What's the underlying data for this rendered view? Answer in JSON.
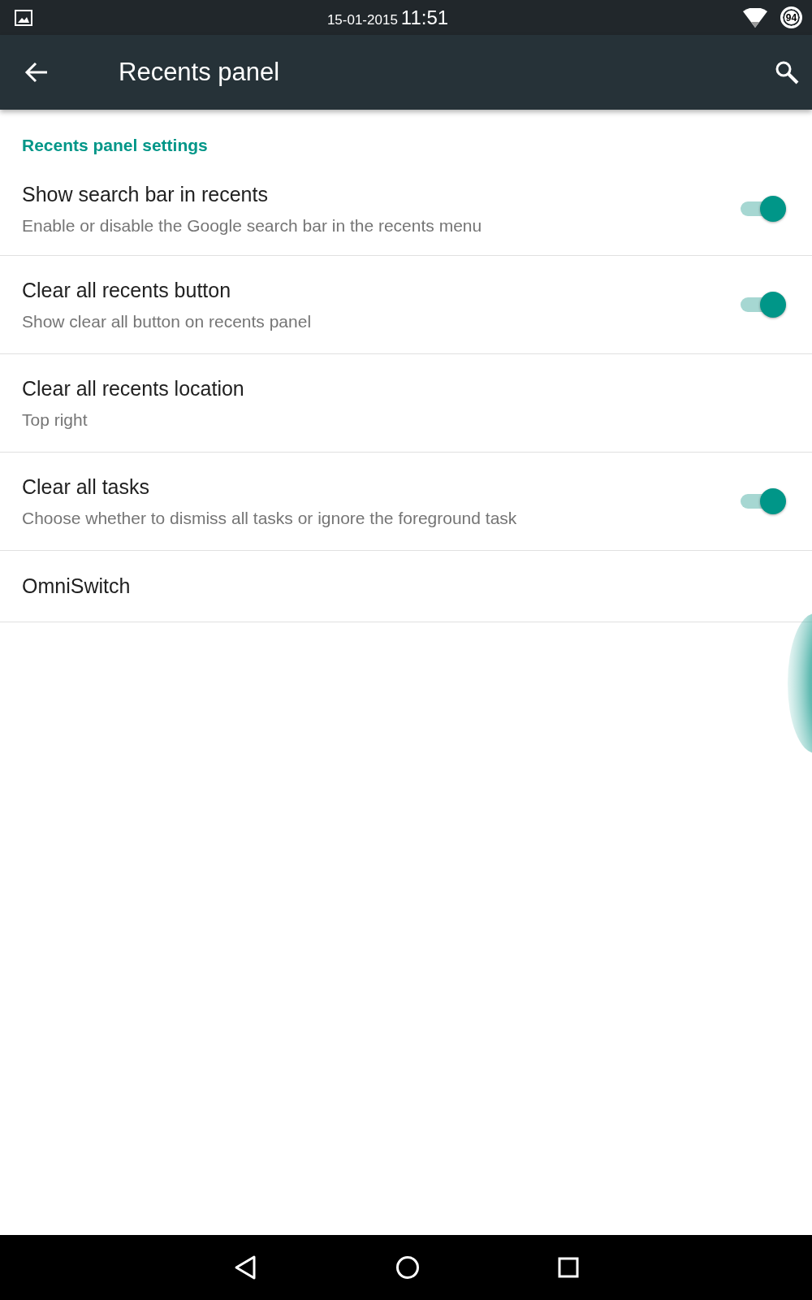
{
  "status_bar": {
    "date": "15-01-2015",
    "time": "11:51",
    "battery": "94"
  },
  "toolbar": {
    "title": "Recents panel"
  },
  "section": {
    "title": "Recents panel settings"
  },
  "settings": [
    {
      "kind": "switch",
      "title": "Show search bar in recents",
      "summary": "Enable or disable the Google search bar in the recents menu",
      "on": true
    },
    {
      "kind": "switch",
      "title": "Clear all recents button",
      "summary": "Show clear all button on recents panel",
      "on": true
    },
    {
      "kind": "plain",
      "title": "Clear all recents location",
      "summary": "Top right"
    },
    {
      "kind": "switch",
      "title": "Clear all tasks",
      "summary": "Choose whether to dismiss all tasks or ignore the foreground task",
      "on": true
    },
    {
      "kind": "plain",
      "title": "OmniSwitch"
    }
  ]
}
